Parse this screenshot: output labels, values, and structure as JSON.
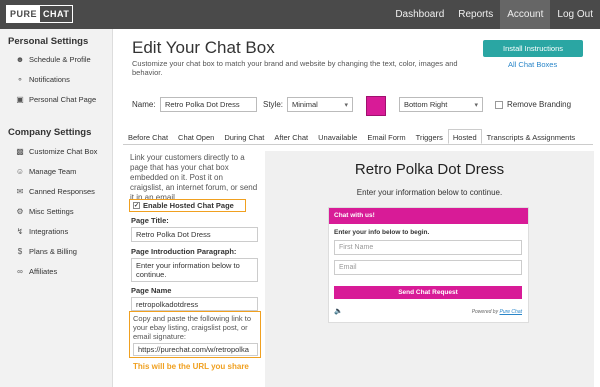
{
  "brand": {
    "part1": "PURE",
    "part2": "CHAT"
  },
  "nav": {
    "items": [
      "Dashboard",
      "Reports",
      "Account",
      "Log Out"
    ],
    "active": "Account"
  },
  "sidebar": {
    "personal_heading": "Personal Settings",
    "personal_items": [
      {
        "label": "Schedule & Profile",
        "icon": "user-icon"
      },
      {
        "label": "Notifications",
        "icon": "bell-icon"
      },
      {
        "label": "Personal Chat Page",
        "icon": "page-icon"
      }
    ],
    "company_heading": "Company Settings",
    "company_items": [
      {
        "label": "Customize Chat Box",
        "icon": "chat-icon"
      },
      {
        "label": "Manage Team",
        "icon": "team-icon"
      },
      {
        "label": "Canned Responses",
        "icon": "message-icon"
      },
      {
        "label": "Misc Settings",
        "icon": "gear-icon"
      },
      {
        "label": "Integrations",
        "icon": "plug-icon"
      },
      {
        "label": "Plans & Billing",
        "icon": "dollar-icon"
      },
      {
        "label": "Affiliates",
        "icon": "share-icon"
      }
    ]
  },
  "header": {
    "title": "Edit Your Chat Box",
    "description": "Customize your chat box to match your brand and website by changing the text, color, images and behavior.",
    "install_button": "Install Instructions",
    "all_boxes_link": "All Chat Boxes"
  },
  "settings": {
    "name_label": "Name:",
    "name_value": "Retro Polka Dot Dress",
    "style_label": "Style:",
    "style_value": "Minimal",
    "color": "#d81b97",
    "position_value": "Bottom Right",
    "remove_branding_label": "Remove Branding"
  },
  "tabs": [
    "Before Chat",
    "Chat Open",
    "During Chat",
    "After Chat",
    "Unavailable",
    "Email Form",
    "Triggers",
    "Hosted",
    "Transcripts & Assignments"
  ],
  "active_tab": "Hosted",
  "hosted": {
    "description": "Link your customers directly to a page that has your chat box embedded on it. Post it on craigslist, an internet forum, or send it in an email.",
    "enable_label": "Enable Hosted Chat Page",
    "page_title_label": "Page Title:",
    "page_title_value": "Retro Polka Dot Dress",
    "intro_label": "Page Introduction Paragraph:",
    "intro_value": "Enter your information below to continue.",
    "page_name_label": "Page Name",
    "page_name_value": "retropolkadotdress",
    "copy_text": "Copy and paste the following link to your ebay listing, craigslist post, or email signature:",
    "url_value": "https://purechat.com/w/retropolka",
    "url_note": "This will be the URL you share"
  },
  "preview": {
    "title": "Retro Polka Dot Dress",
    "subtitle": "Enter your information below to continue.",
    "chat_header": "Chat with us!",
    "chat_intro": "Enter your info below to begin.",
    "first_name_placeholder": "First Name",
    "email_placeholder": "Email",
    "send_button": "Send Chat Request",
    "powered_prefix": "Powered by",
    "powered_brand": "Pure Chat"
  }
}
